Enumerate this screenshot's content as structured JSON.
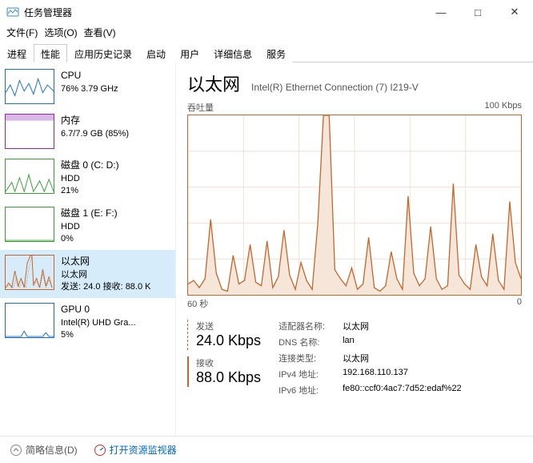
{
  "window": {
    "title": "任务管理器",
    "minimize": "—",
    "maximize": "□",
    "close": "✕"
  },
  "menubar": {
    "file": "文件(F)",
    "options": "选项(O)",
    "view": "查看(V)"
  },
  "tabs": {
    "processes": "进程",
    "performance": "性能",
    "history": "应用历史记录",
    "startup": "启动",
    "users": "用户",
    "details": "详细信息",
    "services": "服务"
  },
  "sidebar": {
    "cpu": {
      "name": "CPU",
      "line1": "76%  3.79 GHz"
    },
    "memory": {
      "name": "内存",
      "line1": "6.7/7.9 GB (85%)"
    },
    "disk0": {
      "name": "磁盘 0 (C: D:)",
      "sub": "HDD",
      "pct": "21%"
    },
    "disk1": {
      "name": "磁盘 1 (E: F:)",
      "sub": "HDD",
      "pct": "0%"
    },
    "ethernet": {
      "name": "以太网",
      "sub": "以太网",
      "line": "发送: 24.0  接收: 88.0 K"
    },
    "gpu": {
      "name": "GPU 0",
      "sub": "Intel(R) UHD Gra...",
      "pct": "5%"
    }
  },
  "main": {
    "title": "以太网",
    "subtitle": "Intel(R) Ethernet Connection (7) I219-V",
    "chart_label_left": "吞吐量",
    "chart_label_right": "100 Kbps",
    "chart_axis_left": "60 秒",
    "chart_axis_right": "0",
    "send_label": "发送",
    "send_value": "24.0 Kbps",
    "recv_label": "接收",
    "recv_value": "88.0 Kbps",
    "details": {
      "adapter_k": "适配器名称:",
      "adapter_v": "以太网",
      "dns_k": "DNS 名称:",
      "dns_v": "lan",
      "conn_k": "连接类型:",
      "conn_v": "以太网",
      "ipv4_k": "IPv4 地址:",
      "ipv4_v": "192.168.110.137",
      "ipv6_k": "IPv6 地址:",
      "ipv6_v": "fe80::ccf0:4ac7:7d52:edaf%22"
    }
  },
  "footer": {
    "brief": "简略信息(D)",
    "resmon": "打开资源监视器"
  },
  "chart_data": {
    "type": "line",
    "title": "吞吐量",
    "xlabel": "秒",
    "ylabel": "Kbps",
    "ylim": [
      0,
      100
    ],
    "xrange_seconds": [
      60,
      0
    ],
    "series": [
      {
        "name": "发送",
        "style": "dashed",
        "values": [
          2,
          3,
          1,
          5,
          38,
          8,
          1,
          0,
          15,
          2,
          4,
          20,
          3,
          2,
          22,
          1,
          6,
          28,
          7,
          1,
          12,
          4,
          1,
          35,
          100,
          100,
          8,
          5,
          2,
          10,
          1,
          3,
          25,
          1,
          0,
          2,
          18,
          5,
          1,
          48,
          8,
          2,
          6,
          30,
          5,
          1,
          2,
          55,
          7,
          3,
          1,
          22,
          6,
          2,
          26,
          4,
          1,
          45,
          12,
          5
        ]
      },
      {
        "name": "接收",
        "style": "solid",
        "values": [
          6,
          8,
          4,
          9,
          42,
          12,
          3,
          2,
          22,
          6,
          8,
          28,
          7,
          5,
          30,
          4,
          10,
          36,
          11,
          3,
          18,
          8,
          3,
          40,
          100,
          100,
          14,
          9,
          5,
          15,
          3,
          6,
          32,
          4,
          2,
          5,
          24,
          9,
          3,
          55,
          12,
          5,
          9,
          38,
          9,
          3,
          5,
          62,
          11,
          6,
          3,
          28,
          10,
          5,
          34,
          8,
          3,
          52,
          18,
          9
        ]
      }
    ]
  }
}
